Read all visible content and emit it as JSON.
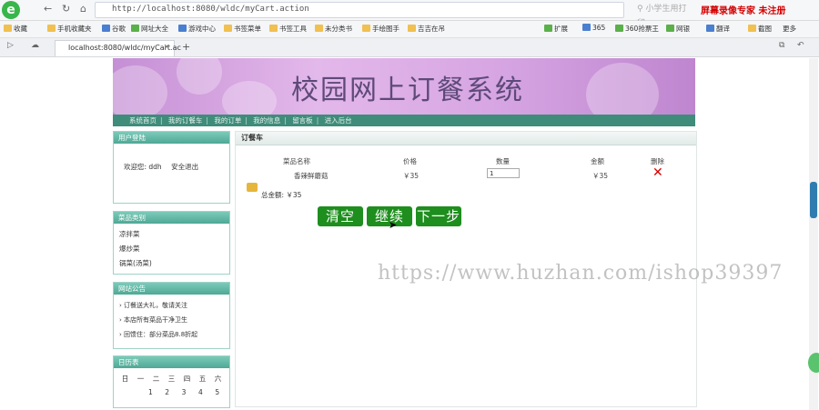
{
  "browser": {
    "url": "http://localhost:8080/wldc/myCart.action",
    "search_placeholder": "小学生用打印...",
    "brand_overlay": "屏幕录像专家 未注册",
    "bookmarks": [
      "收藏",
      "手机收藏夹",
      "谷歌",
      "网址大全",
      "游戏中心",
      "书签菜单",
      "书签工具",
      "未分类书",
      "手绘图手",
      "吉吉在吊"
    ],
    "extras": [
      "扩展",
      "365",
      "360抢票王",
      "网银",
      "翻译",
      "截图",
      "更多"
    ],
    "tab_title": "localhost:8080/wldc/myCart.ac"
  },
  "site": {
    "title": "校园网上订餐系统",
    "nav": [
      "系统首页",
      "我的订餐车",
      "我的订单",
      "我的信息",
      "留言板",
      "进入后台"
    ]
  },
  "sidebar": {
    "login": {
      "title": "用户登陆",
      "welcome": "欢迎您: ddh",
      "logout": "安全退出"
    },
    "categories": {
      "title": "菜品类别",
      "items": [
        "凉拌菜",
        "爆炒菜",
        "锅菜(汤菜)"
      ]
    },
    "news": {
      "title": "网站公告",
      "items": [
        "订餐送大礼，敬请关注",
        "本店所有菜品干净卫生",
        "回馈住：部分菜品8.8折起"
      ]
    },
    "calendar": {
      "title": "日历表",
      "weekdays": [
        "日",
        "一",
        "二",
        "三",
        "四",
        "五",
        "六"
      ],
      "first_row": [
        "",
        "",
        "",
        "1",
        "2",
        "3",
        "4",
        "5"
      ]
    }
  },
  "cart": {
    "title": "订餐车",
    "headers": [
      "菜品名称",
      "价格",
      "数量",
      "金额",
      "删除"
    ],
    "rows": [
      {
        "name": "香辣鲜蘑菇",
        "price": "￥35",
        "qty": "1",
        "amount": "￥35"
      }
    ],
    "total_label": "总金额: ￥35",
    "buttons": {
      "clear": "清空",
      "continue": "继续",
      "next": "下一步"
    }
  },
  "watermark": "https://www.huzhan.com/ishop39397"
}
